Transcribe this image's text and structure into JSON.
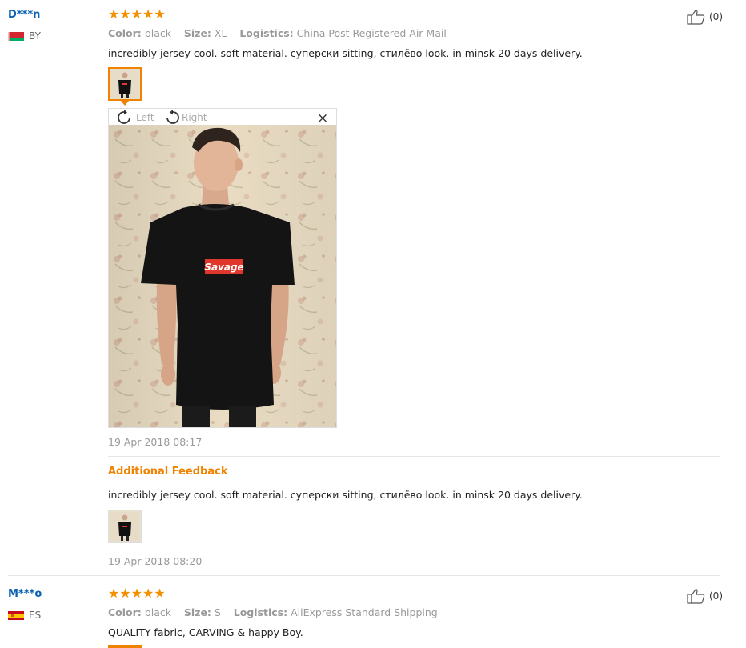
{
  "reviews": [
    {
      "user": "D***n",
      "country": "BY",
      "stars": "★★★★★",
      "color_label": "Color:",
      "color_value": "black",
      "size_label": "Size:",
      "size_value": "XL",
      "logistics_label": "Logistics:",
      "logistics_value": "China Post Registered Air Mail",
      "text": "incredibly jersey cool. soft material. суперски sitting, стилёво look. in minsk 20 days delivery.",
      "likes": "(0)",
      "viewer": {
        "left_label": "Left",
        "right_label": "Right",
        "close": "×",
        "shirt_text": "Savage"
      },
      "date": "19 Apr 2018 08:17",
      "additional": {
        "title": "Additional Feedback",
        "text": "incredibly jersey cool. soft material. суперски sitting, стилёво look. in minsk 20 days delivery.",
        "date": "19 Apr 2018 08:20"
      }
    },
    {
      "user": "M***o",
      "country": "ES",
      "stars": "★★★★★",
      "color_label": "Color:",
      "color_value": "black",
      "size_label": "Size:",
      "size_value": "S",
      "logistics_label": "Logistics:",
      "logistics_value": "AliExpress Standard Shipping",
      "text": "QUALITY fabric, CARVING & happy Boy.",
      "likes": "(0)"
    }
  ],
  "colors": {
    "accent": "#f08200",
    "link": "#0a62b0",
    "star": "#f29100"
  }
}
